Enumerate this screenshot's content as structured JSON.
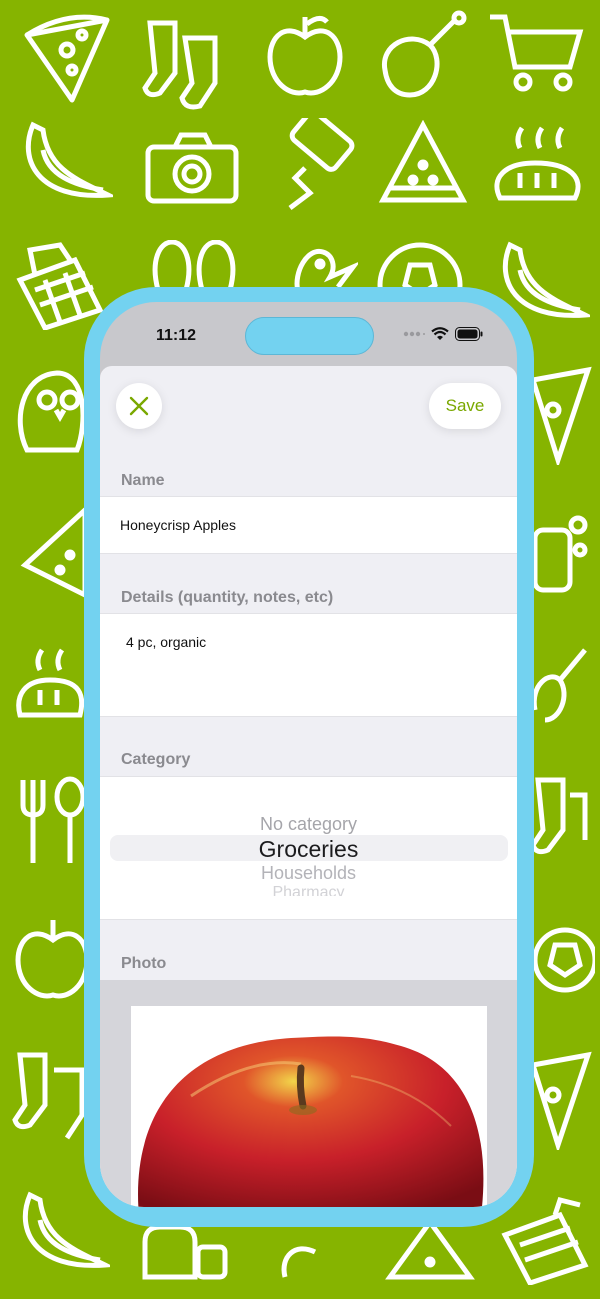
{
  "colors": {
    "background": "#86b400",
    "device_frame": "#73d2f0",
    "accent": "#7aa800"
  },
  "status_bar": {
    "time": "11:12",
    "icons": [
      "cellular-dots-icon",
      "wifi-icon",
      "battery-icon"
    ]
  },
  "nav": {
    "close_icon": "close-icon",
    "save_label": "Save"
  },
  "form": {
    "name": {
      "label": "Name",
      "value": "Honeycrisp Apples"
    },
    "details": {
      "label": "Details (quantity, notes, etc)",
      "value": "4 pc, organic"
    },
    "category": {
      "label": "Category",
      "options": [
        "No category",
        "Groceries",
        "Households",
        "Pharmacy"
      ],
      "selected": "Groceries"
    },
    "photo": {
      "label": "Photo",
      "image": "red-apple-photo"
    }
  }
}
